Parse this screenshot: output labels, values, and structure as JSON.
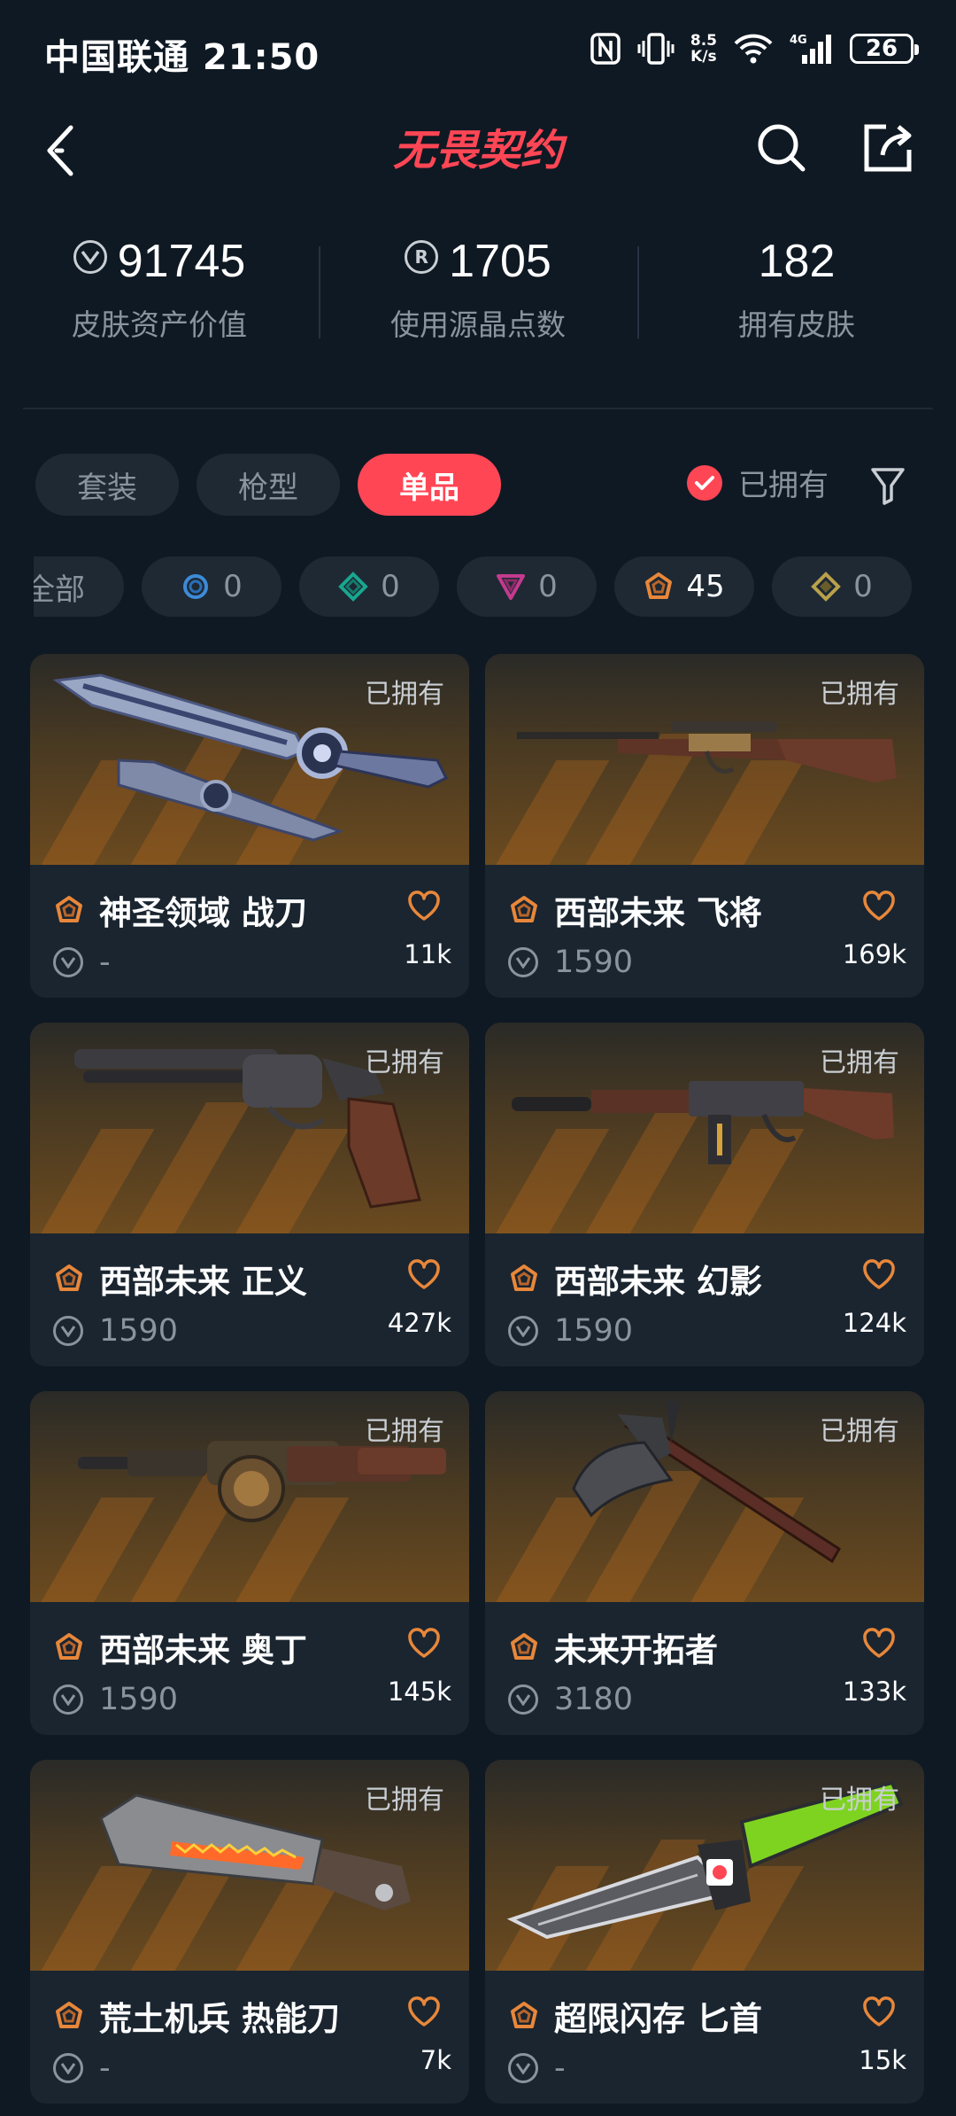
{
  "status_bar": {
    "carrier_time": "中国联通 21:50",
    "net_speed_value": "8.5",
    "net_speed_unit": "K/s",
    "network": "4G",
    "battery": "26"
  },
  "header": {
    "logo_text": "无畏契约"
  },
  "stats": [
    {
      "value": "91745",
      "label": "皮肤资产价值",
      "icon": "vp-coin-icon"
    },
    {
      "value": "1705",
      "label": "使用源晶点数",
      "icon": "radianite-icon"
    },
    {
      "value": "182",
      "label": "拥有皮肤",
      "icon": ""
    }
  ],
  "tabs": [
    "套装",
    "枪型",
    "单品"
  ],
  "active_tab": "单品",
  "owned_filter": {
    "label": "已拥有",
    "checked": true
  },
  "rarity_chips": [
    {
      "label": "全部",
      "count": ""
    },
    {
      "label": "",
      "count": "0",
      "color": "#3d8bd8"
    },
    {
      "label": "",
      "count": "0",
      "color": "#19a68f"
    },
    {
      "label": "",
      "count": "0",
      "color": "#c43a8e"
    },
    {
      "label": "",
      "count": "45",
      "color": "#e8873a"
    },
    {
      "label": "",
      "count": "0",
      "color": "#b9a14b"
    }
  ],
  "colors": {
    "accent": "#ff4655",
    "tier_orange": "#e8873a",
    "background": "#0f1923",
    "card": "#1a2530"
  },
  "cards": [
    {
      "owned": "已拥有",
      "title": "神圣领域 战刀",
      "price": "-",
      "likes": "11k",
      "weapon": "blade"
    },
    {
      "owned": "已拥有",
      "title": "西部未来 飞将",
      "price": "1590",
      "likes": "169k",
      "weapon": "rifle"
    },
    {
      "owned": "已拥有",
      "title": "西部未来 正义",
      "price": "1590",
      "likes": "427k",
      "weapon": "revolver"
    },
    {
      "owned": "已拥有",
      "title": "西部未来 幻影",
      "price": "1590",
      "likes": "124k",
      "weapon": "phantom"
    },
    {
      "owned": "已拥有",
      "title": "西部未来 奥丁",
      "price": "1590",
      "likes": "145k",
      "weapon": "odin"
    },
    {
      "owned": "已拥有",
      "title": "未来开拓者",
      "price": "3180",
      "likes": "133k",
      "weapon": "axe"
    },
    {
      "owned": "已拥有",
      "title": "荒土机兵 热能刀",
      "price": "-",
      "likes": "7k",
      "weapon": "heatblade"
    },
    {
      "owned": "已拥有",
      "title": "超限闪存 匕首",
      "price": "-",
      "likes": "15k",
      "weapon": "dagger"
    }
  ]
}
